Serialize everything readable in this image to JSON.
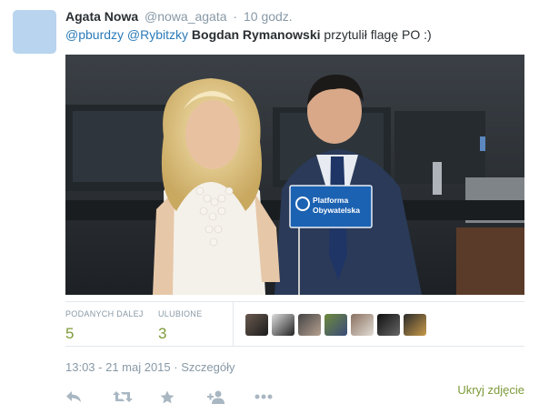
{
  "tweet": {
    "author_name": "Agata Nowa",
    "author_handle": "@nowa_agata",
    "separator": "·",
    "time_ago": "10 godz.",
    "mention_1": "@pburdzy",
    "mention_2": "@Rybitzky",
    "bold_text": "Bogdan Rymanowski",
    "text_rest": "przytulił flagę PO :)"
  },
  "photo": {
    "sign_line_1": "Platforma",
    "sign_line_2": "Obywatelska"
  },
  "stats": {
    "retweets_label": "PODANYCH DALEJ",
    "retweets_value": "5",
    "favorites_label": "ULUBIONE",
    "favorites_value": "3"
  },
  "timestamp": {
    "text": "13:03 - 21 maj 2015",
    "separator": "·",
    "details": "Szczegóły"
  },
  "actions": {
    "icons": [
      "reply-icon",
      "retweet-icon",
      "favorite-icon",
      "follow-icon",
      "more-icon"
    ],
    "hide_photo_label": "Ukryj zdjęcie"
  },
  "colors": {
    "link": "#2b7bb9",
    "accent": "#7d9a3a",
    "muted": "#8899a6"
  }
}
